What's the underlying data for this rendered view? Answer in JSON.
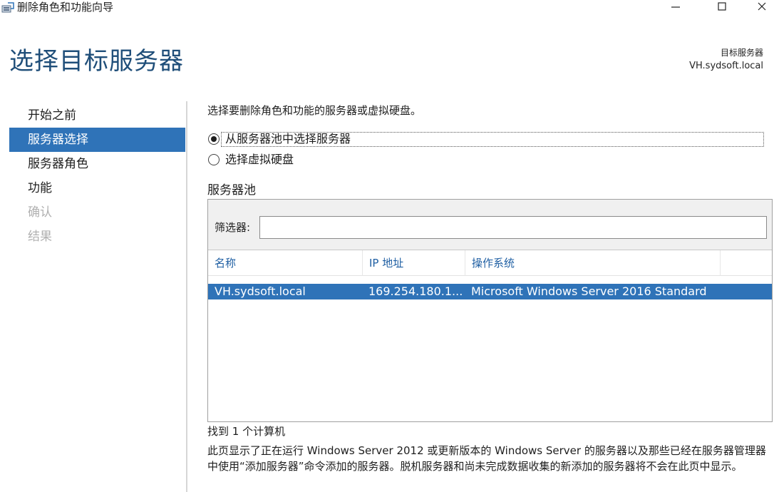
{
  "window": {
    "title": "删除角色和功能向导",
    "minimize_glyph": "—",
    "maximize_glyph": "☐",
    "close_glyph": "✕"
  },
  "header": {
    "title": "选择目标服务器",
    "destination_label": "目标服务器",
    "destination_value": "VH.sydsoft.local"
  },
  "nav": {
    "items": [
      {
        "label": "开始之前",
        "state": "normal"
      },
      {
        "label": "服务器选择",
        "state": "active"
      },
      {
        "label": "服务器角色",
        "state": "normal"
      },
      {
        "label": "功能",
        "state": "normal"
      },
      {
        "label": "确认",
        "state": "disabled"
      },
      {
        "label": "结果",
        "state": "disabled"
      }
    ]
  },
  "content": {
    "instruction": "选择要删除角色和功能的服务器或虚拟硬盘。",
    "options": [
      {
        "label": "从服务器池中选择服务器",
        "checked": true
      },
      {
        "label": "选择虚拟硬盘",
        "checked": false
      }
    ],
    "pool_heading": "服务器池",
    "filter_label": "筛选器:",
    "filter_value": "",
    "columns": [
      "名称",
      "IP 地址",
      "操作系统"
    ],
    "rows": [
      {
        "name": "VH.sydsoft.local",
        "ip": "169.254.180.1...",
        "os": "Microsoft Windows Server 2016 Standard",
        "selected": true
      }
    ],
    "found_text": "找到 1 个计算机",
    "description": "此页显示了正在运行 Windows Server 2012 或更新版本的 Windows Server 的服务器以及那些已经在服务器管理器中使用“添加服务器”命令添加的服务器。脱机服务器和尚未完成数据收集的新添加的服务器将不会在此页中显示。"
  },
  "colors": {
    "accent": "#2f73b8",
    "title": "#1f4e79",
    "column_header": "#1f5fa3",
    "disabled": "#b0b0b0"
  },
  "icons": {
    "app": "server-manager-icon",
    "minimize": "minimize-icon",
    "maximize": "maximize-icon",
    "close": "close-icon"
  }
}
